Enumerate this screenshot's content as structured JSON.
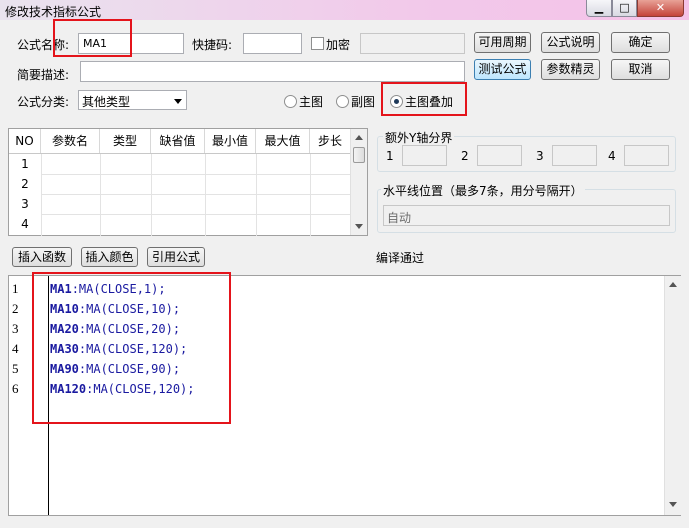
{
  "window": {
    "title": "修改技术指标公式",
    "min": "▁",
    "max": "□",
    "close": "✕"
  },
  "form": {
    "name_label": "公式名称:",
    "name_value": "MA1",
    "hotkey_label": "快捷码:",
    "hotkey_value": "",
    "encrypt_label": "加密",
    "desc_label": "简要描述:",
    "desc_value": "",
    "category_label": "公式分类:",
    "category_value": "其他类型",
    "radio_main": "主图",
    "radio_sub": "副图",
    "radio_overlay": "主图叠加",
    "selected_radio": "overlay"
  },
  "buttons": {
    "available_period": "可用周期",
    "formula_help": "公式说明",
    "ok": "确定",
    "test_formula": "测试公式",
    "param_wizard": "参数精灵",
    "cancel": "取消",
    "insert_function": "插入函数",
    "insert_color": "插入颜色",
    "reference_formula": "引用公式"
  },
  "param_table": {
    "columns": [
      "NO",
      "参数名",
      "类型",
      "缺省值",
      "最小值",
      "最大值",
      "步长"
    ],
    "rows": [
      "1",
      "2",
      "3",
      "4"
    ]
  },
  "y_axis": {
    "title": "额外Y轴分界",
    "labels": [
      "1",
      "2",
      "3",
      "4"
    ]
  },
  "hline": {
    "title": "水平线位置（最多7条，用分号隔开）",
    "value": "自动"
  },
  "compile_status": "编译通过",
  "code_lines": [
    {
      "num": "1",
      "var": "MA1",
      "rest": ":MA(CLOSE,1);"
    },
    {
      "num": "2",
      "var": "MA10",
      "rest": ":MA(CLOSE,10);"
    },
    {
      "num": "3",
      "var": "MA20",
      "rest": ":MA(CLOSE,20);"
    },
    {
      "num": "4",
      "var": "MA30",
      "rest": ":MA(CLOSE,120);"
    },
    {
      "num": "5",
      "var": "MA90",
      "rest": ":MA(CLOSE,90);"
    },
    {
      "num": "6",
      "var": "MA120",
      "rest": ":MA(CLOSE,120);"
    }
  ],
  "colors": {
    "highlight_box": "#e4141b",
    "keyword": "#1a1aa0"
  }
}
